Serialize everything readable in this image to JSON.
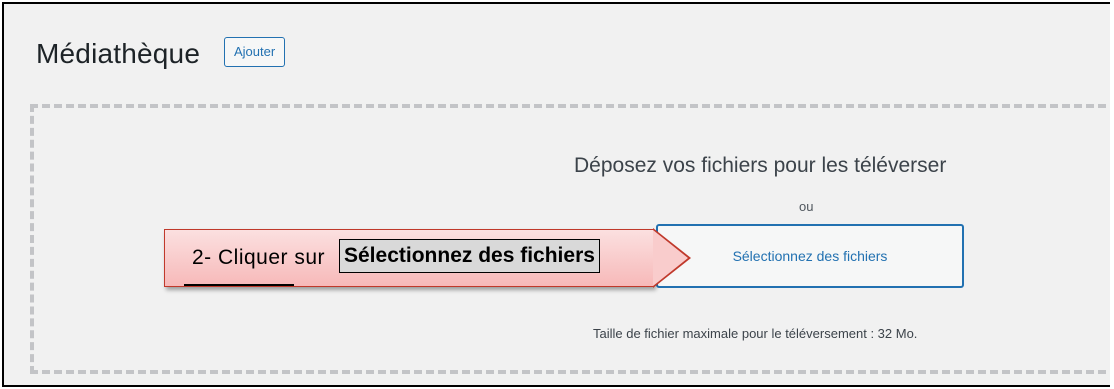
{
  "header": {
    "title": "Médiathèque",
    "add_button": "Ajouter"
  },
  "upload": {
    "drop_text": "Déposez vos fichiers pour les téléverser",
    "or_text": "ou",
    "select_button": "Sélectionnez des fichiers",
    "max_size_text": "Taille de fichier maximale pour le téléversement : 32 Mo."
  },
  "annotation": {
    "prefix": "2- Cliquer sur",
    "highlight": "Sélectionnez des fichiers"
  },
  "colors": {
    "accent": "#2271b1",
    "callout_fill": "#f7b9b9",
    "callout_border": "#c0392b"
  }
}
